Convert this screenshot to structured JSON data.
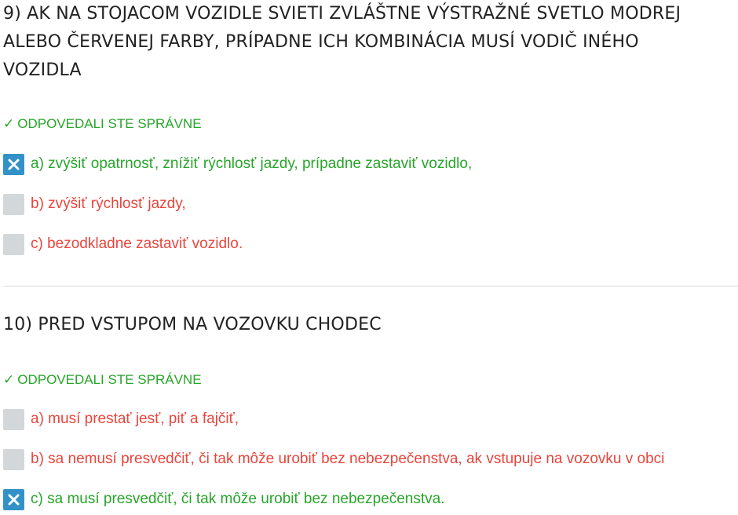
{
  "colors": {
    "correct": "#27a52a",
    "wrong": "#e8453c",
    "checkbox_checked": "#3292c8",
    "checkbox_empty": "#d4d7da",
    "title": "#222222"
  },
  "questions": [
    {
      "title": "9) AK NA STOJACOM VOZIDLE SVIETI ZVLÁŠTNE VÝSTRAŽNÉ SVETLO MODREJ\nALEBO ČERVENEJ FARBY, PRÍPADNE ICH KOMBINÁCIA MUSÍ VODIČ INÉHO\nVOZIDLA",
      "status": "ODPOVEDALI STE SPRÁVNE",
      "status_icon": "check-icon",
      "answers": [
        {
          "text": "a) zvýšiť opatrnosť, znížiť rýchlosť jazdy, prípadne zastaviť vozidlo,",
          "checked": true,
          "correct": true
        },
        {
          "text": "b) zvýšiť rýchlosť jazdy,",
          "checked": false,
          "correct": false
        },
        {
          "text": "c) bezodkladne zastaviť vozidlo.",
          "checked": false,
          "correct": false
        }
      ]
    },
    {
      "title": "10) PRED VSTUPOM NA VOZOVKU CHODEC",
      "status": "ODPOVEDALI STE SPRÁVNE",
      "status_icon": "check-icon",
      "answers": [
        {
          "text": "a) musí prestať jesť, piť a fajčiť,",
          "checked": false,
          "correct": false
        },
        {
          "text": "b) sa nemusí presvedčiť, či tak môže urobiť bez nebezpečenstva, ak vstupuje na vozovku v obci",
          "checked": false,
          "correct": false
        },
        {
          "text": "c) sa musí presvedčiť, či tak môže urobiť bez nebezpečenstva.",
          "checked": true,
          "correct": true
        }
      ]
    }
  ]
}
